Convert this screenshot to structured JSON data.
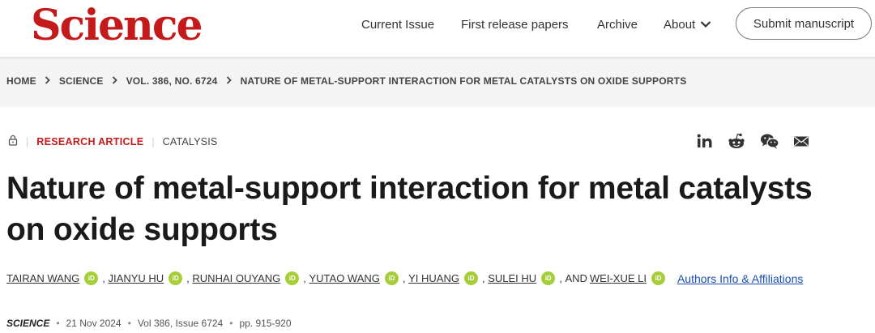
{
  "brand": {
    "logo_text": "Science",
    "color": "#c51a1b"
  },
  "nav": {
    "current_issue": "Current Issue",
    "first_release": "First release papers",
    "archive": "Archive",
    "about": "About",
    "submit": "Submit manuscript"
  },
  "breadcrumb": {
    "home": "HOME",
    "science": "SCIENCE",
    "volume": "VOL. 386, NO. 6724",
    "current": "NATURE OF METAL-SUPPORT INTERACTION FOR METAL CATALYSTS ON OXIDE SUPPORTS"
  },
  "article": {
    "kicker": "RESEARCH ARTICLE",
    "subject": "CATALYSIS",
    "title": "Nature of metal-support interaction for metal catalysts on oxide supports",
    "authors": [
      "TAIRAN WANG",
      "JIANYU HU",
      "RUNHAI OUYANG",
      "YUTAO WANG",
      "YI HUANG",
      "SULEI HU",
      "WEI-XUE LI"
    ],
    "orcid_badge": "iD",
    "and_text": "AND",
    "affiliations_link": "Authors Info & Affiliations",
    "journal": "SCIENCE",
    "date": "21 Nov 2024",
    "volume_issue": "Vol 386, Issue 6724",
    "pages": "pp. 915-920"
  },
  "share_icons": [
    "linkedin-icon",
    "reddit-icon",
    "wechat-icon",
    "email-icon"
  ],
  "colors": {
    "accent": "#c51a1b",
    "link": "#1b4fb0",
    "orcid": "#a6ce39",
    "crumb_bg": "#f4f4f4"
  }
}
